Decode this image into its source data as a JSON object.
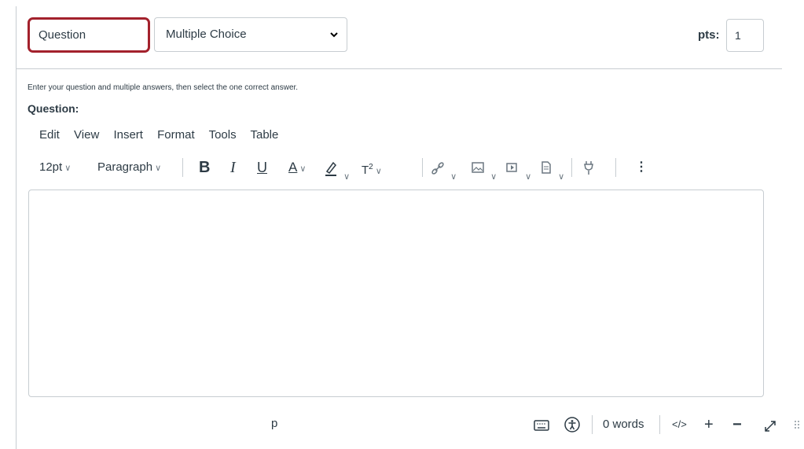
{
  "question_form": {
    "title_value": "Question",
    "type_select": "Multiple Choice",
    "points_label": "pts:",
    "points_value": "1",
    "instructions": "Enter your question and multiple answers, then select the one correct answer.",
    "question_label": "Question:"
  },
  "editor": {
    "menus": [
      "Edit",
      "View",
      "Insert",
      "Format",
      "Tools",
      "Table"
    ],
    "font_size": "12pt",
    "block_format": "Paragraph",
    "toolbar_icons": [
      "bold-icon",
      "italic-icon",
      "underline-icon",
      "text-color-icon",
      "highlight-color-icon",
      "superscript-icon",
      "link-icon",
      "image-icon",
      "media-icon",
      "document-icon",
      "apps-plugin-icon",
      "more-options-icon"
    ],
    "status_path": "p",
    "word_count": "0 words",
    "html_toggle": "</>"
  },
  "colors": {
    "focus_border": "#a3212c",
    "text": "#2d3b45",
    "border": "#c7cdd1"
  }
}
